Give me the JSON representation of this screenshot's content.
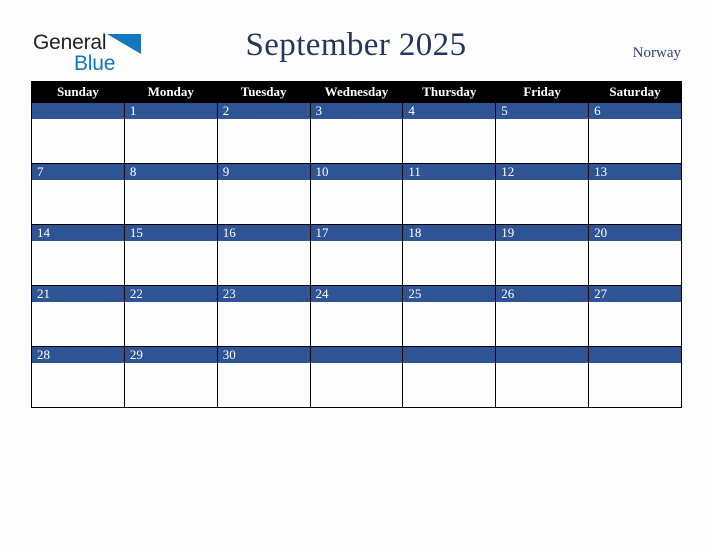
{
  "brand": {
    "name_part1": "General",
    "name_part2": "Blue",
    "triangle_icon": "blue-triangle-icon",
    "dark_color": "#231f20",
    "blue_color": "#1277bf"
  },
  "header": {
    "title": "September 2025",
    "region": "Norway",
    "title_color": "#24365e",
    "region_color": "#2f4470"
  },
  "calendar": {
    "month": "September",
    "year": "2025",
    "header_bg": "#000000",
    "header_text_color": "#ffffff",
    "daynum_bg": "#2f5496",
    "daynum_text_color": "#ffffff",
    "cell_bg": "#fdfdfd",
    "border_color": "#000000",
    "weekday_headers": [
      "Sunday",
      "Monday",
      "Tuesday",
      "Wednesday",
      "Thursday",
      "Friday",
      "Saturday"
    ],
    "weeks": [
      [
        "",
        "1",
        "2",
        "3",
        "4",
        "5",
        "6"
      ],
      [
        "7",
        "8",
        "9",
        "10",
        "11",
        "12",
        "13"
      ],
      [
        "14",
        "15",
        "16",
        "17",
        "18",
        "19",
        "20"
      ],
      [
        "21",
        "22",
        "23",
        "24",
        "25",
        "26",
        "27"
      ],
      [
        "28",
        "29",
        "30",
        "",
        "",
        "",
        ""
      ]
    ]
  }
}
